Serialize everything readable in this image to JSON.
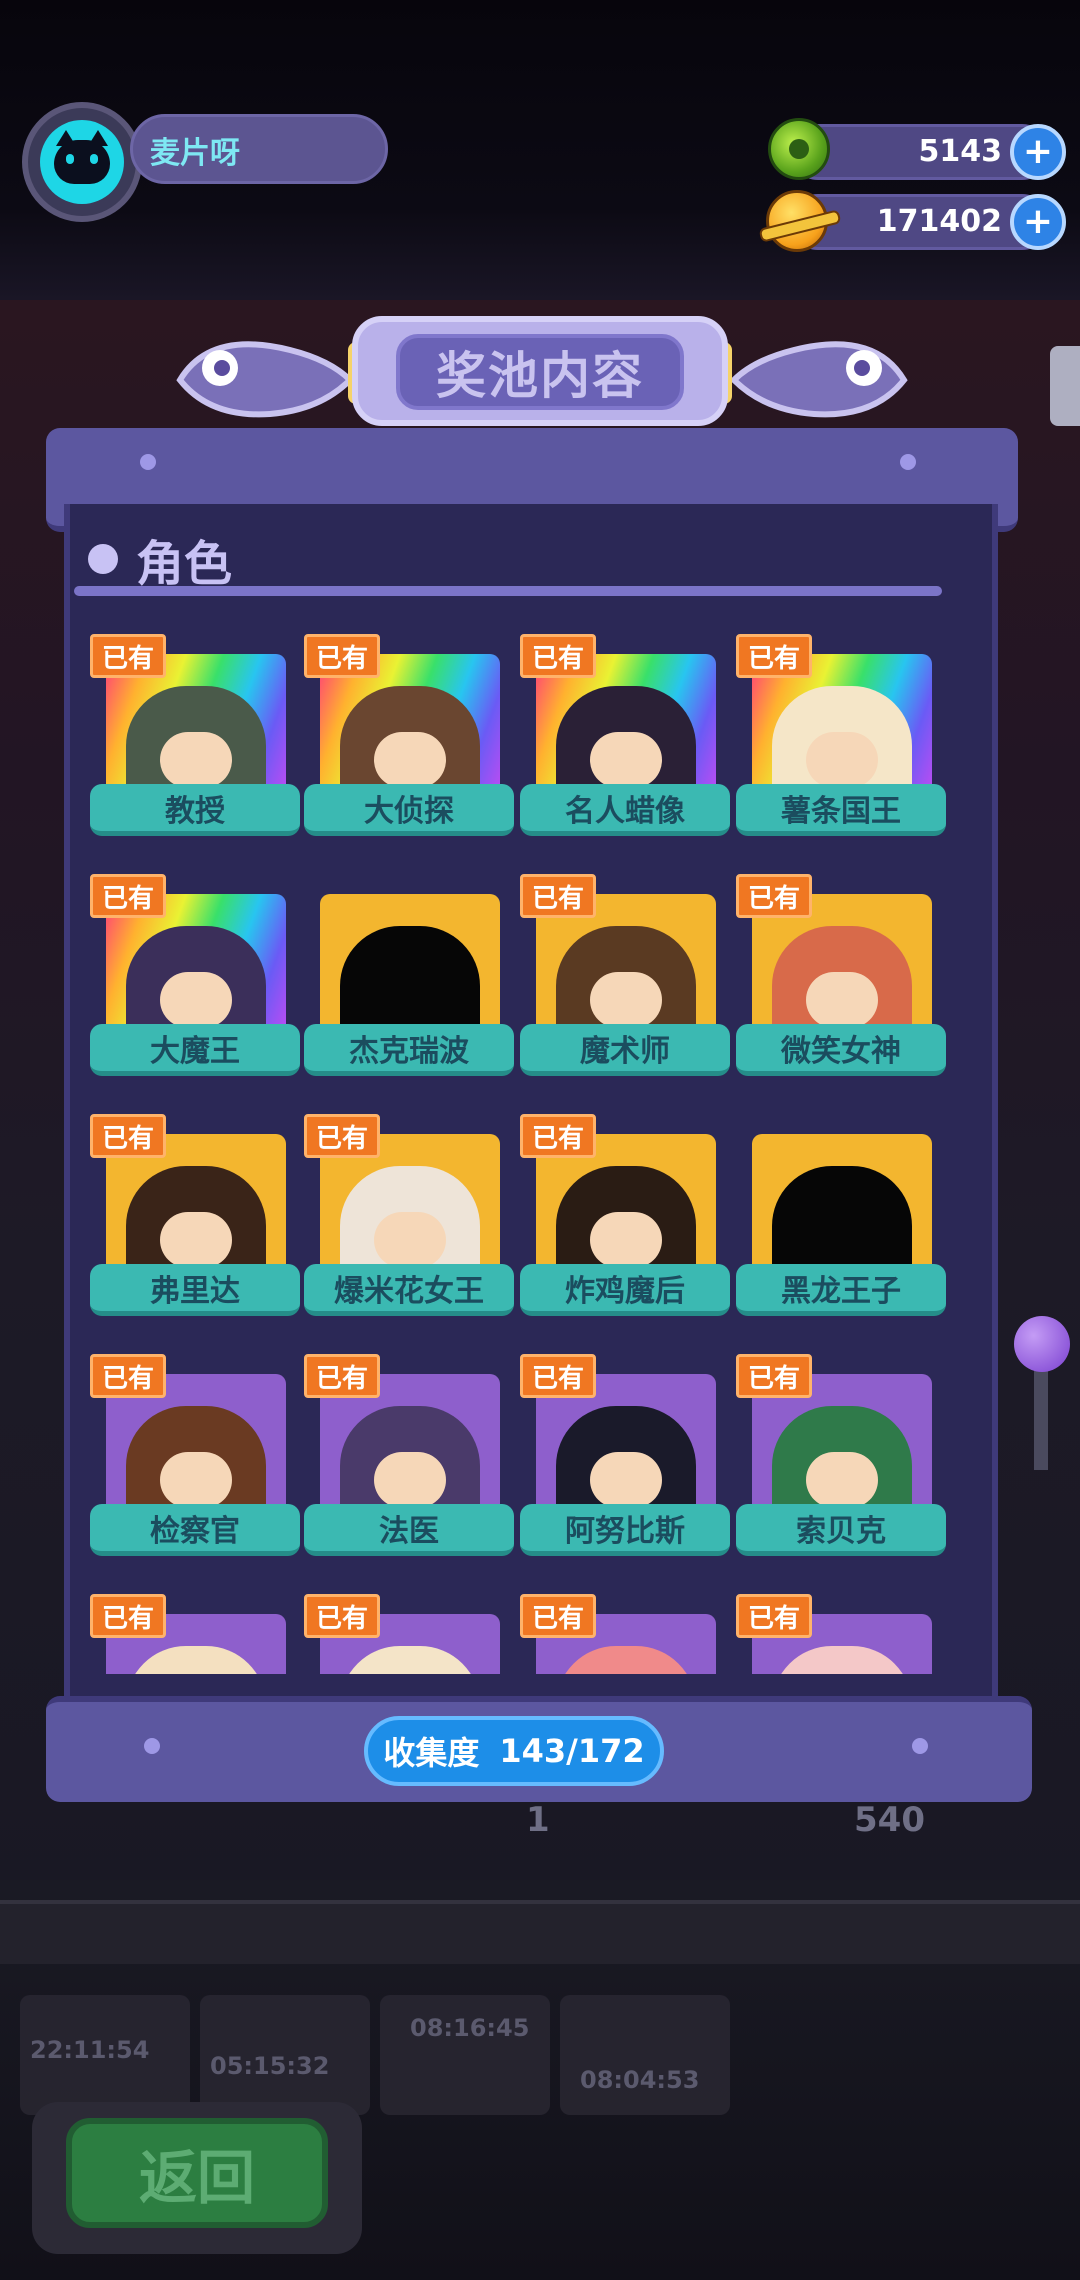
{
  "player": {
    "name": "麦片呀"
  },
  "currencies": [
    {
      "name": "green-coin",
      "value": "5143"
    },
    {
      "name": "planet-coin",
      "value": "171402"
    }
  ],
  "plus_symbol": "+",
  "header": {
    "title": "奖池内容"
  },
  "section": {
    "title": "角色"
  },
  "owned_badge": "已有",
  "characters": [
    {
      "name": "教授",
      "owned": true,
      "rarity": "rainbow"
    },
    {
      "name": "大侦探",
      "owned": true,
      "rarity": "rainbow"
    },
    {
      "name": "名人蜡像",
      "owned": true,
      "rarity": "rainbow"
    },
    {
      "name": "薯条国王",
      "owned": true,
      "rarity": "rainbow"
    },
    {
      "name": "大魔王",
      "owned": true,
      "rarity": "rainbow"
    },
    {
      "name": "杰克瑞波",
      "owned": false,
      "rarity": "gold"
    },
    {
      "name": "魔术师",
      "owned": true,
      "rarity": "gold"
    },
    {
      "name": "微笑女神",
      "owned": true,
      "rarity": "gold"
    },
    {
      "name": "弗里达",
      "owned": true,
      "rarity": "gold"
    },
    {
      "name": "爆米花女王",
      "owned": true,
      "rarity": "gold"
    },
    {
      "name": "炸鸡魔后",
      "owned": true,
      "rarity": "gold"
    },
    {
      "name": "黑龙王子",
      "owned": false,
      "rarity": "gold"
    },
    {
      "name": "检察官",
      "owned": true,
      "rarity": "purple"
    },
    {
      "name": "法医",
      "owned": true,
      "rarity": "purple"
    },
    {
      "name": "阿努比斯",
      "owned": true,
      "rarity": "purple"
    },
    {
      "name": "索贝克",
      "owned": true,
      "rarity": "purple"
    },
    {
      "name": "",
      "owned": true,
      "rarity": "purple"
    },
    {
      "name": "",
      "owned": true,
      "rarity": "purple"
    },
    {
      "name": "",
      "owned": true,
      "rarity": "purple"
    },
    {
      "name": "",
      "owned": true,
      "rarity": "purple"
    }
  ],
  "collection": {
    "label": "收集度",
    "value": "143/172"
  },
  "background_counters": {
    "left": "1",
    "right": "540"
  },
  "background_timers": [
    "22:11:54",
    "05:15:32",
    "08:16:45",
    "08:04:53"
  ],
  "back_button": {
    "label": "返回"
  },
  "colors": {
    "accent_teal": "#3bb9b2",
    "badge_orange": "#f07722",
    "panel": "#2b2856",
    "progress_blue": "#1d8ee8"
  }
}
